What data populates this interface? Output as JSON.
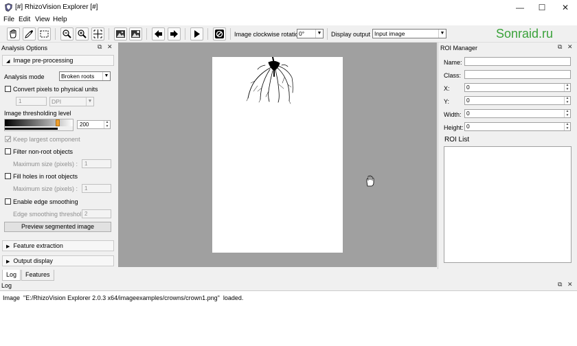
{
  "window": {
    "title": "[#] RhizoVision Explorer [#]",
    "controls": {
      "minimize": "—",
      "maximize": "☐",
      "close": "✕"
    }
  },
  "menu": [
    "File",
    "Edit",
    "View",
    "Help"
  ],
  "toolbar": {
    "rotation_label": "Image clockwise rotation:",
    "rotation_value": "0°",
    "display_label": "Display output :",
    "display_value": "Input image"
  },
  "watermark": "Sonraid.ru",
  "analysis_options": {
    "title": "Analysis Options",
    "preprocessing_header": "Image pre-processing",
    "analysis_mode_label": "Analysis mode",
    "analysis_mode_value": "Broken roots",
    "convert_pixels_label": "Convert pixels to physical units",
    "convert_value": "1",
    "convert_unit": "DPI",
    "threshold_label": "Image thresholding level",
    "threshold_value": "200",
    "threshold_fraction": 0.78,
    "keep_largest_label": "Keep largest component",
    "filter_nonroot_label": "Filter non-root objects",
    "max_size_label_1": "Maximum size (pixels) :",
    "max_size_value_1": "1",
    "fill_holes_label": "Fill holes in root objects",
    "max_size_label_2": "Maximum size (pixels) :",
    "max_size_value_2": "1",
    "edge_smoothing_label": "Enable edge smoothing",
    "edge_threshold_label": "Edge smoothing threshold :",
    "edge_threshold_value": "2",
    "preview_button": "Preview segmented image",
    "feature_extraction_header": "Feature extraction",
    "output_display_header": "Output display"
  },
  "roi_manager": {
    "title": "ROI Manager",
    "name_label": "Name:",
    "name_value": "",
    "class_label": "Class:",
    "class_value": "",
    "x_label": "X:",
    "x_value": "0",
    "y_label": "Y:",
    "y_value": "0",
    "width_label": "Width:",
    "width_value": "0",
    "height_label": "Height:",
    "height_value": "0",
    "roi_list_label": "ROI List"
  },
  "bottom_tabs": [
    "Log",
    "Features"
  ],
  "log": {
    "title": "Log",
    "message": "Image  \"E:/RhizoVision Explorer 2.0.3 x64/imageexamples/crowns/crown1.png\"  loaded."
  },
  "colors": {
    "canvas_bg": "#a0a0a0",
    "accent_green": "#3aa23a",
    "slider_handle": "#f0a030"
  }
}
